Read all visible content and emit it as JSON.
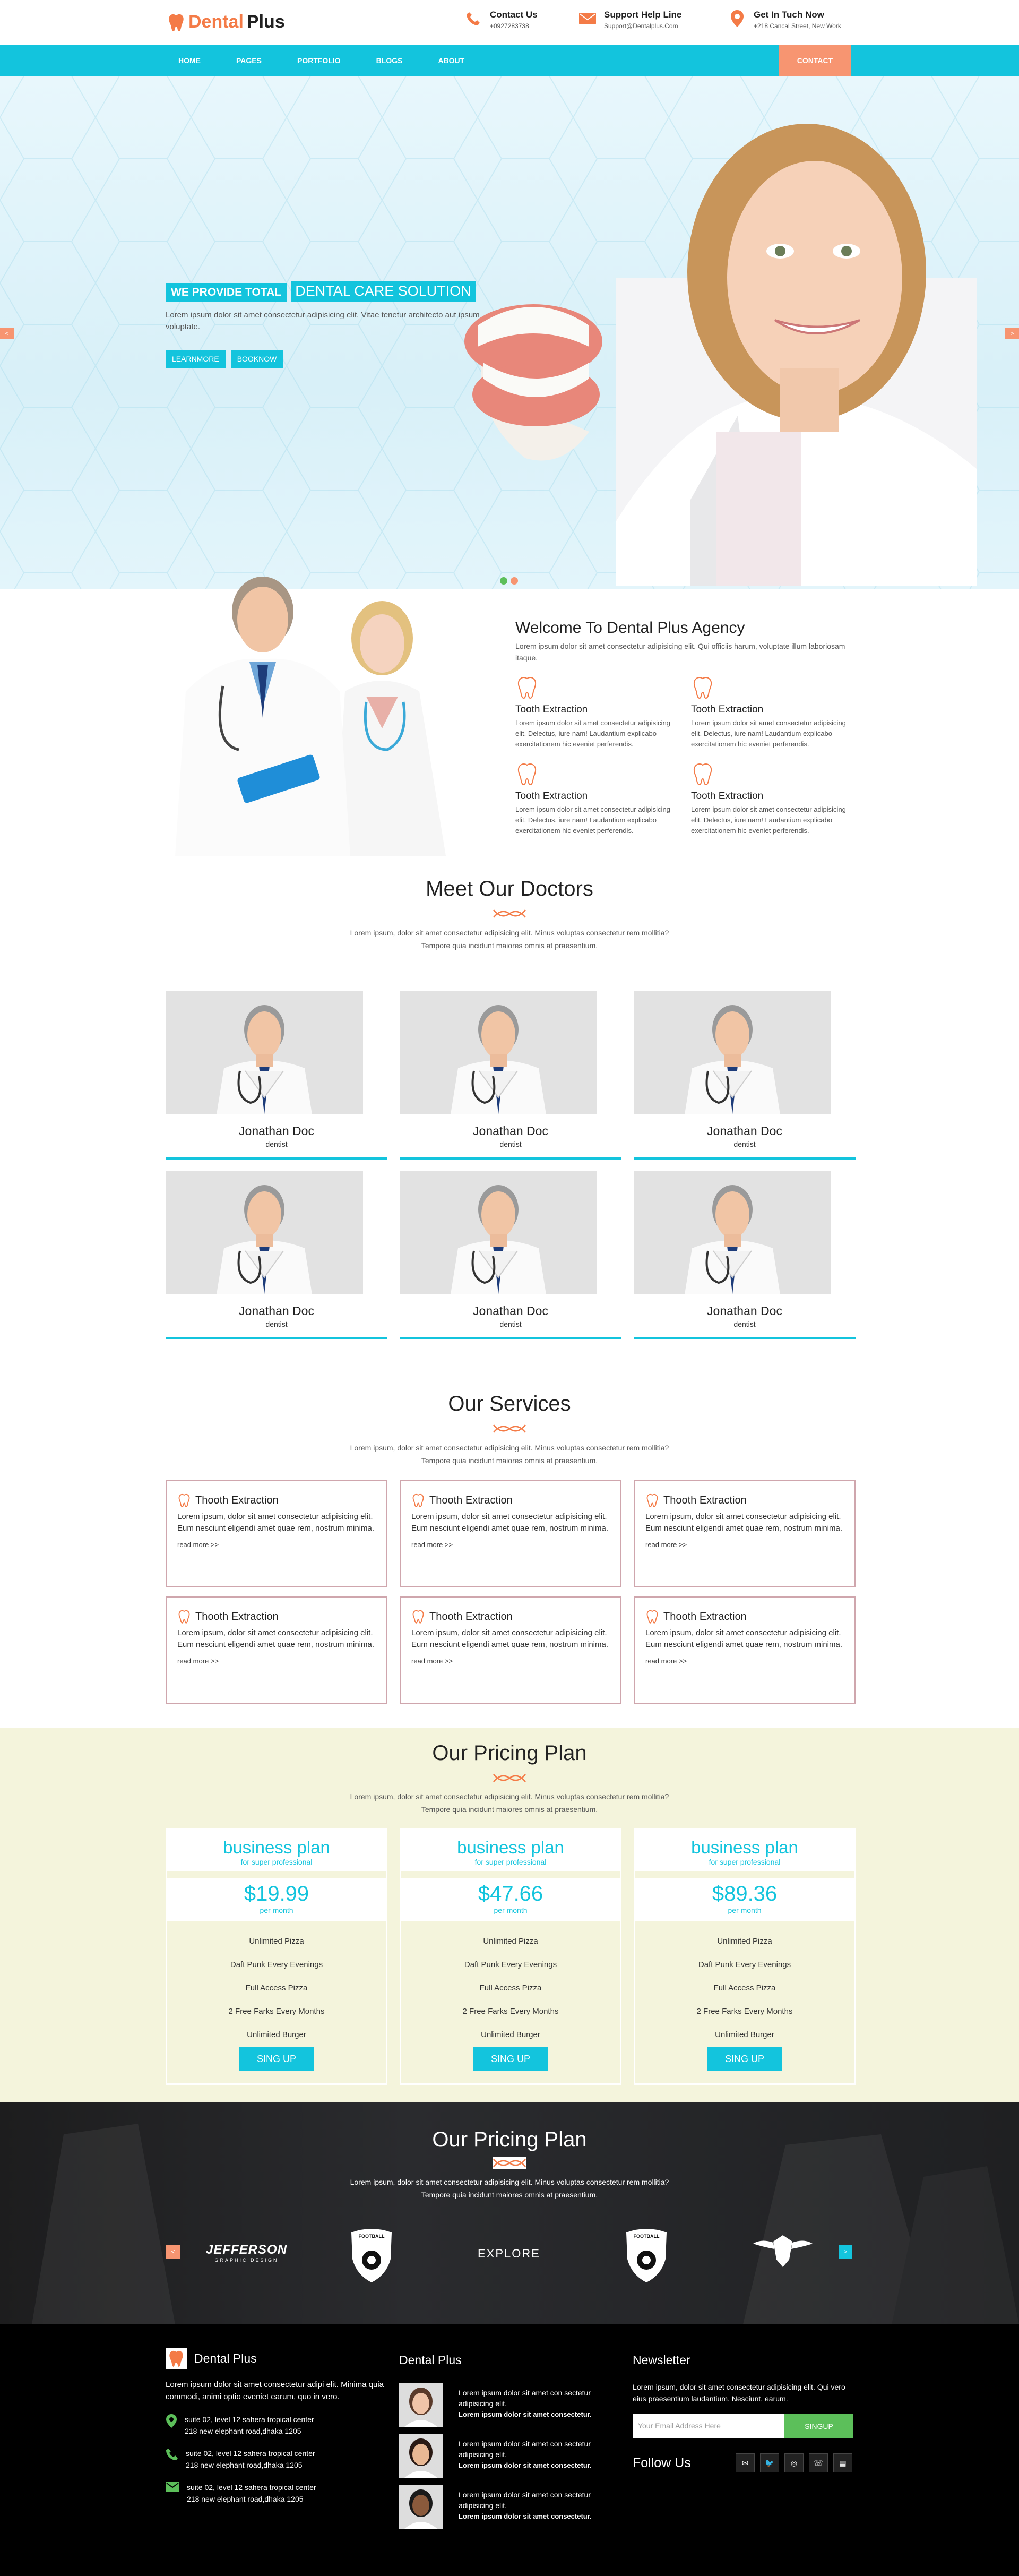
{
  "header": {
    "logo_word1": "Dental",
    "logo_word2": "Plus",
    "contact": {
      "title": "Contact Us",
      "value": "+0927283738"
    },
    "support": {
      "title": "Support Help Line",
      "value": "Support@Dentalplus.Com"
    },
    "location": {
      "title": "Get In Tuch Now",
      "value": "+218 Cancal Street, New Work"
    }
  },
  "nav": {
    "items": [
      "HOME",
      "PAGES",
      "PORTFOLIO",
      "BLOGS",
      "ABOUT"
    ],
    "contact": "CONTACT"
  },
  "hero": {
    "tag1": "WE PROVIDE TOTAL",
    "tag2": "DENTAL CARE SOLUTION",
    "text": "Lorem ipsum dolor sit amet consectetur adipisicing elit. Vitae tenetur architecto aut ipsum voluptate.",
    "btn1": "LEARNMORE",
    "btn2": "BOOKNOW",
    "arrow_left": "<",
    "arrow_right": ">"
  },
  "welcome": {
    "title": "Welcome To Dental Plus Agency",
    "desc": "Lorem ipsum dolor sit amet consectetur adipisicing elit. Qui officiis harum, voluptate illum laboriosam itaque.",
    "features": [
      {
        "title": "Tooth Extraction",
        "text": "Lorem ipsum dolor sit amet consectetur adipisicing elit. Delectus, iure nam! Laudantium explicabo exercitationem hic eveniet perferendis."
      },
      {
        "title": "Tooth Extraction",
        "text": "Lorem ipsum dolor sit amet consectetur adipisicing elit. Delectus, iure nam! Laudantium explicabo exercitationem hic eveniet perferendis."
      },
      {
        "title": "Tooth Extraction",
        "text": "Lorem ipsum dolor sit amet consectetur adipisicing elit. Delectus, iure nam! Laudantium explicabo exercitationem hic eveniet perferendis."
      },
      {
        "title": "Tooth Extraction",
        "text": "Lorem ipsum dolor sit amet consectetur adipisicing elit. Delectus, iure nam! Laudantium explicabo exercitationem hic eveniet perferendis."
      }
    ]
  },
  "doctors": {
    "title": "Meet Our Doctors",
    "desc_line1": "Lorem ipsum, dolor sit amet consectetur adipisicing elit. Minus voluptas consectetur rem mollitia?",
    "desc_line2": "Tempore quia incidunt maiores omnis at praesentium.",
    "cards": [
      {
        "name": "Jonathan Doc",
        "role": "dentist"
      },
      {
        "name": "Jonathan Doc",
        "role": "dentist"
      },
      {
        "name": "Jonathan Doc",
        "role": "dentist"
      },
      {
        "name": "Jonathan Doc",
        "role": "dentist"
      },
      {
        "name": "Jonathan Doc",
        "role": "dentist"
      },
      {
        "name": "Jonathan Doc",
        "role": "dentist"
      }
    ]
  },
  "services": {
    "title": "Our Services",
    "desc_line1": "Lorem ipsum, dolor sit amet consectetur adipisicing elit. Minus voluptas consectetur rem mollitia?",
    "desc_line2": "Tempore quia incidunt maiores omnis at praesentium.",
    "cards": [
      {
        "title": "Thooth Extraction",
        "text": "Lorem ipsum, dolor sit amet consectetur adipisicing elit. Eum nesciunt eligendi amet quae rem, nostrum minima.",
        "more": "read more >>"
      },
      {
        "title": "Thooth Extraction",
        "text": "Lorem ipsum, dolor sit amet consectetur adipisicing elit. Eum nesciunt eligendi amet quae rem, nostrum minima.",
        "more": "read more >>"
      },
      {
        "title": "Thooth Extraction",
        "text": "Lorem ipsum, dolor sit amet consectetur adipisicing elit. Eum nesciunt eligendi amet quae rem, nostrum minima.",
        "more": "read more >>"
      },
      {
        "title": "Thooth Extraction",
        "text": "Lorem ipsum, dolor sit amet consectetur adipisicing elit. Eum nesciunt eligendi amet quae rem, nostrum minima.",
        "more": "read more >>"
      },
      {
        "title": "Thooth Extraction",
        "text": "Lorem ipsum, dolor sit amet consectetur adipisicing elit. Eum nesciunt eligendi amet quae rem, nostrum minima.",
        "more": "read more >>"
      },
      {
        "title": "Thooth Extraction",
        "text": "Lorem ipsum, dolor sit amet consectetur adipisicing elit. Eum nesciunt eligendi amet quae rem, nostrum minima.",
        "more": "read more >>"
      }
    ]
  },
  "pricing": {
    "title": "Our Pricing Plan",
    "desc_line1": "Lorem ipsum, dolor sit amet consectetur adipisicing elit. Minus voluptas consectetur rem mollitia?",
    "desc_line2": "Tempore quia incidunt maiores omnis at praesentium.",
    "plans": [
      {
        "name": "business plan",
        "sub": "for super professional",
        "price": "$19.99",
        "period": "per month",
        "features": [
          "Unlimited Pizza",
          "Daft Punk Every Evenings",
          "Full Access Pizza",
          "2 Free Farks Every Months",
          "Unlimited Burger"
        ],
        "button": "SING UP"
      },
      {
        "name": "business plan",
        "sub": "for super professional",
        "price": "$47.66",
        "period": "per month",
        "features": [
          "Unlimited Pizza",
          "Daft Punk Every Evenings",
          "Full Access Pizza",
          "2 Free Farks Every Months",
          "Unlimited Burger"
        ],
        "button": "SING UP"
      },
      {
        "name": "business plan",
        "sub": "for super professional",
        "price": "$89.36",
        "period": "per month",
        "features": [
          "Unlimited Pizza",
          "Daft Punk Every Evenings",
          "Full Access Pizza",
          "2 Free Farks Every Months",
          "Unlimited Burger"
        ],
        "button": "SING UP"
      }
    ]
  },
  "partners": {
    "title": "Our Pricing Plan",
    "desc_line1": "Lorem ipsum, dolor sit amet consectetur adipisicing elit. Minus voluptas consectetur rem mollitia?",
    "desc_line2": "Tempore quia incidunt maiores omnis at praesentium.",
    "logos": [
      "JEFFERSON",
      "GRAPHIC DESIGN",
      "FOOTBALL",
      "EXPLORE",
      "FOOTBALL"
    ],
    "arrow_left": "<",
    "arrow_right": ">"
  },
  "footer": {
    "about": {
      "title": "Dental Plus",
      "text": "Lorem ipsum dolor sit amet consectetur adipi elit. Minima quia commodi, animi optio eveniet earum, quo in vero.",
      "addresses": [
        {
          "line1": "suite 02, level 12 sahera tropical center",
          "line2": "218 new elephant road,dhaka 1205"
        },
        {
          "line1": "suite 02, level 12 sahera tropical center",
          "line2": "218 new elephant road,dhaka 1205"
        },
        {
          "line1": "suite 02, level 12 sahera tropical center",
          "line2": "218 new elephant road,dhaka 1205"
        }
      ]
    },
    "posts": {
      "title": "Dental Plus",
      "items": [
        {
          "text": "Lorem ipsum dolor sit amet con sectetur adipisicing elit.",
          "bold": "Lorem ipsum dolor sit amet consectetur."
        },
        {
          "text": "Lorem ipsum dolor sit amet con sectetur adipisicing elit.",
          "bold": "Lorem ipsum dolor sit amet consectetur."
        },
        {
          "text": "Lorem ipsum dolor sit amet con sectetur adipisicing elit.",
          "bold": "Lorem ipsum dolor sit amet consectetur."
        }
      ]
    },
    "newsletter": {
      "title": "Newsletter",
      "text": "Lorem ipsum, dolor sit amet consectetur adipisicing elit. Qui vero eius praesentium laudantium. Nesciunt, earum.",
      "placeholder": "Your Email Address Here",
      "button": "SINGUP",
      "follow": "Follow Us"
    }
  },
  "colors": {
    "accent": "#13c4dd",
    "brand": "#f47b47",
    "cta": "#f79571",
    "pricing_bg": "#f4f4dc",
    "signup": "#5cbf5a"
  }
}
